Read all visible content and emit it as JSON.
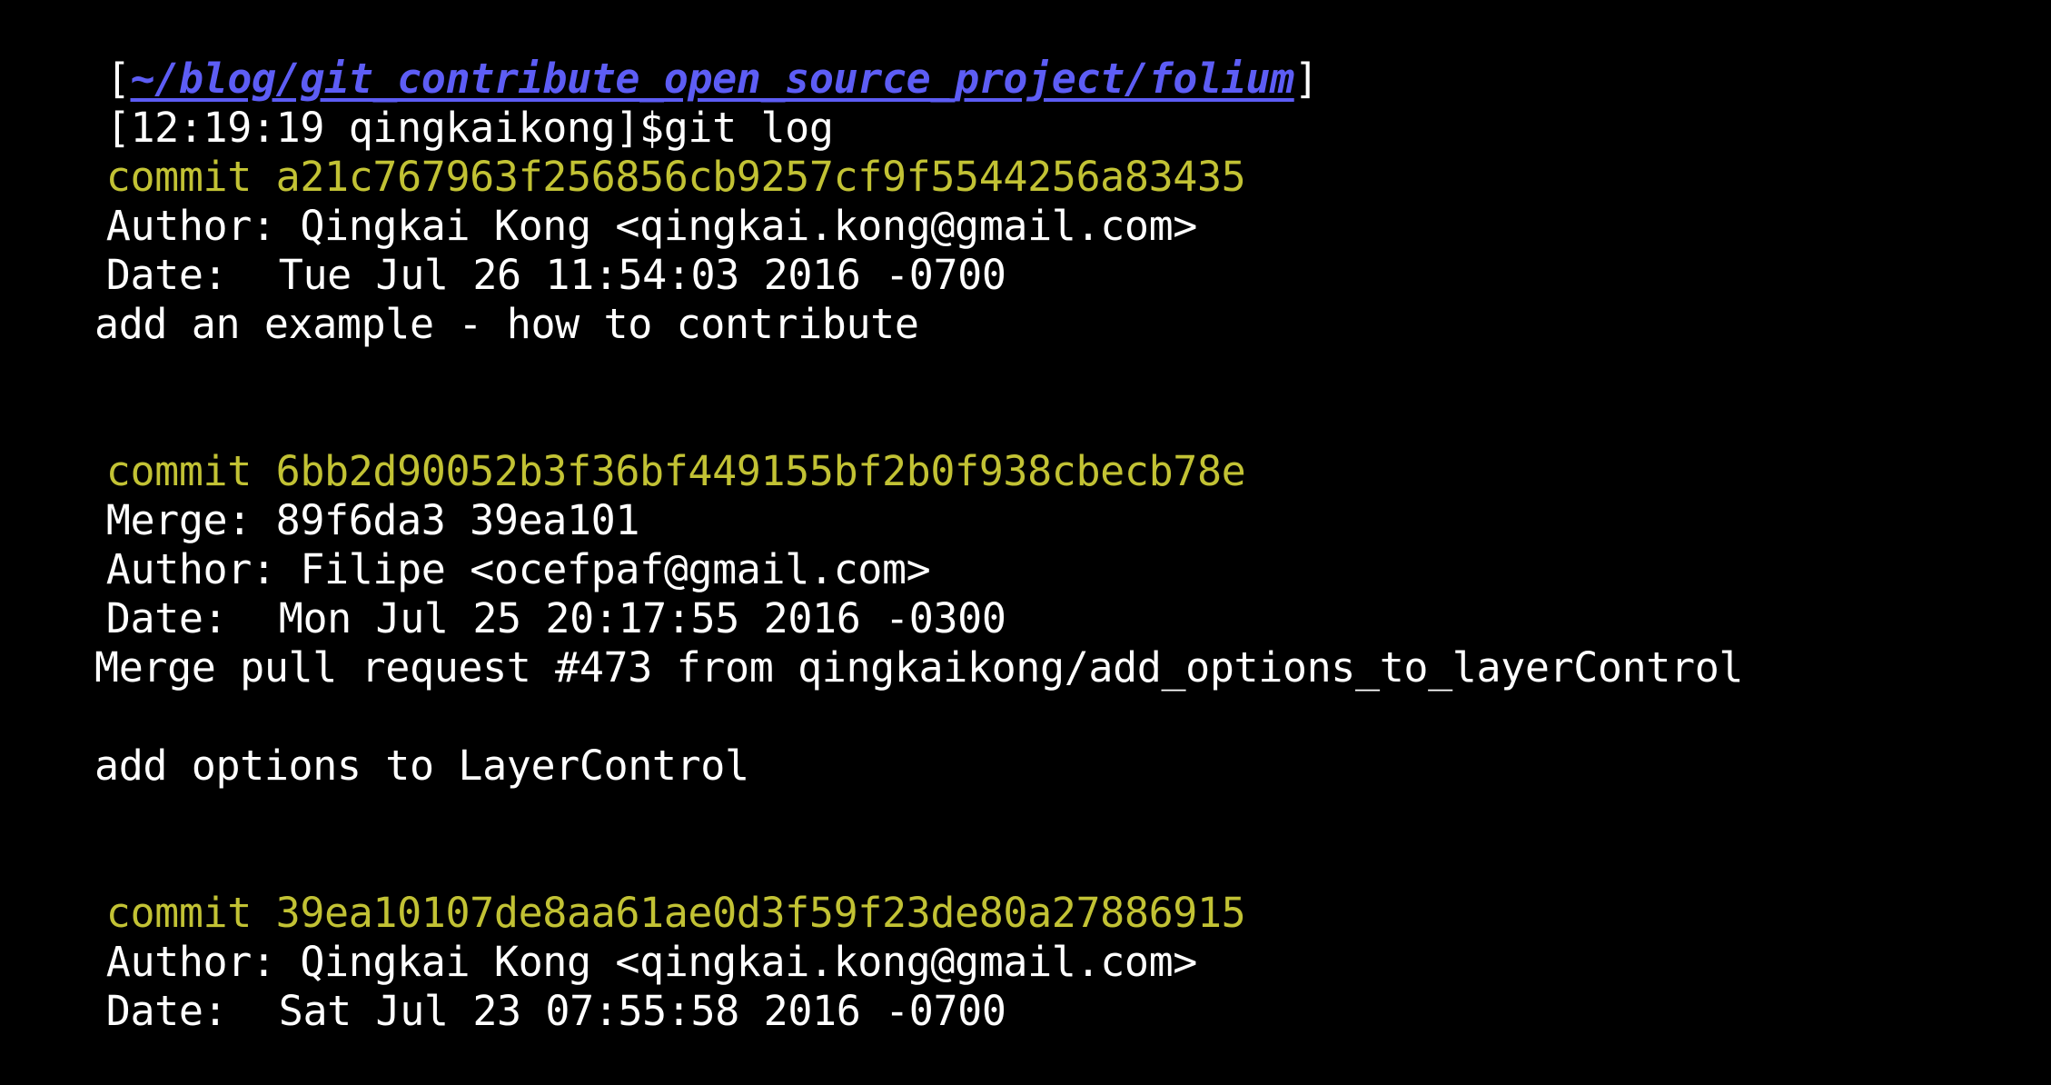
{
  "terminal": {
    "prompt_path": "~/blog/git_contribute_open_source_project/folium",
    "prompt_time_user": "[12:19:19 qingkaikong]$",
    "command": "git log",
    "bracket_open": "[",
    "bracket_close": "]"
  },
  "commits": [
    {
      "commit_label": "commit",
      "hash": "a21c767963f256856cb9257cf9f5544256a83435",
      "author_label": "Author:",
      "author": "Qingkai Kong <qingkai.kong@gmail.com>",
      "date_label": "Date:",
      "date": "Tue Jul 26 11:54:03 2016 -0700",
      "message": "add an example - how to contribute"
    },
    {
      "commit_label": "commit",
      "hash": "6bb2d90052b3f36bf449155bf2b0f938cbecb78e",
      "merge_label": "Merge:",
      "merge": "89f6da3 39ea101",
      "author_label": "Author:",
      "author": "Filipe <ocefpaf@gmail.com>",
      "date_label": "Date:",
      "date": "Mon Jul 25 20:17:55 2016 -0300",
      "message": "Merge pull request #473 from qingkaikong/add_options_to_layerControl",
      "message2": "add options to LayerControl"
    },
    {
      "commit_label": "commit",
      "hash": "39ea10107de8aa61ae0d3f59f23de80a27886915",
      "author_label": "Author:",
      "author": "Qingkai Kong <qingkai.kong@gmail.com>",
      "date_label": "Date:",
      "date": "Sat Jul 23 07:55:58 2016 -0700"
    }
  ],
  "colors": {
    "background": "#000000",
    "text": "#ffffff",
    "path": "#5d5df5",
    "commit_hash": "#c2c234"
  }
}
